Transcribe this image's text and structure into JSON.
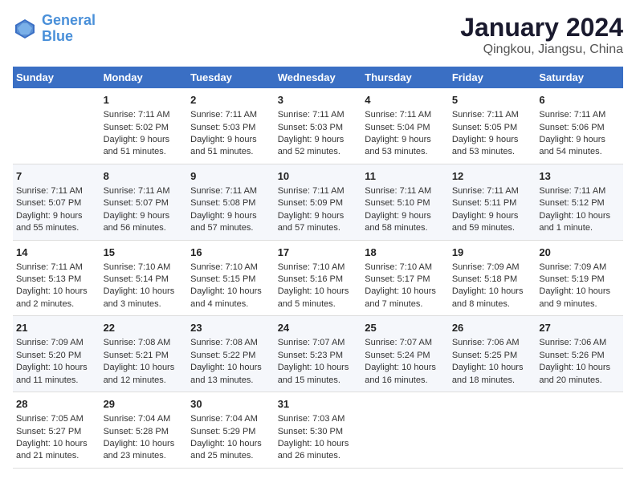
{
  "logo": {
    "line1": "General",
    "line2": "Blue"
  },
  "title": "January 2024",
  "subtitle": "Qingkou, Jiangsu, China",
  "days_of_week": [
    "Sunday",
    "Monday",
    "Tuesday",
    "Wednesday",
    "Thursday",
    "Friday",
    "Saturday"
  ],
  "weeks": [
    [
      {
        "day": "",
        "info": ""
      },
      {
        "day": "1",
        "info": "Sunrise: 7:11 AM\nSunset: 5:02 PM\nDaylight: 9 hours\nand 51 minutes."
      },
      {
        "day": "2",
        "info": "Sunrise: 7:11 AM\nSunset: 5:03 PM\nDaylight: 9 hours\nand 51 minutes."
      },
      {
        "day": "3",
        "info": "Sunrise: 7:11 AM\nSunset: 5:03 PM\nDaylight: 9 hours\nand 52 minutes."
      },
      {
        "day": "4",
        "info": "Sunrise: 7:11 AM\nSunset: 5:04 PM\nDaylight: 9 hours\nand 53 minutes."
      },
      {
        "day": "5",
        "info": "Sunrise: 7:11 AM\nSunset: 5:05 PM\nDaylight: 9 hours\nand 53 minutes."
      },
      {
        "day": "6",
        "info": "Sunrise: 7:11 AM\nSunset: 5:06 PM\nDaylight: 9 hours\nand 54 minutes."
      }
    ],
    [
      {
        "day": "7",
        "info": "Sunrise: 7:11 AM\nSunset: 5:07 PM\nDaylight: 9 hours\nand 55 minutes."
      },
      {
        "day": "8",
        "info": "Sunrise: 7:11 AM\nSunset: 5:07 PM\nDaylight: 9 hours\nand 56 minutes."
      },
      {
        "day": "9",
        "info": "Sunrise: 7:11 AM\nSunset: 5:08 PM\nDaylight: 9 hours\nand 57 minutes."
      },
      {
        "day": "10",
        "info": "Sunrise: 7:11 AM\nSunset: 5:09 PM\nDaylight: 9 hours\nand 57 minutes."
      },
      {
        "day": "11",
        "info": "Sunrise: 7:11 AM\nSunset: 5:10 PM\nDaylight: 9 hours\nand 58 minutes."
      },
      {
        "day": "12",
        "info": "Sunrise: 7:11 AM\nSunset: 5:11 PM\nDaylight: 9 hours\nand 59 minutes."
      },
      {
        "day": "13",
        "info": "Sunrise: 7:11 AM\nSunset: 5:12 PM\nDaylight: 10 hours\nand 1 minute."
      }
    ],
    [
      {
        "day": "14",
        "info": "Sunrise: 7:11 AM\nSunset: 5:13 PM\nDaylight: 10 hours\nand 2 minutes."
      },
      {
        "day": "15",
        "info": "Sunrise: 7:10 AM\nSunset: 5:14 PM\nDaylight: 10 hours\nand 3 minutes."
      },
      {
        "day": "16",
        "info": "Sunrise: 7:10 AM\nSunset: 5:15 PM\nDaylight: 10 hours\nand 4 minutes."
      },
      {
        "day": "17",
        "info": "Sunrise: 7:10 AM\nSunset: 5:16 PM\nDaylight: 10 hours\nand 5 minutes."
      },
      {
        "day": "18",
        "info": "Sunrise: 7:10 AM\nSunset: 5:17 PM\nDaylight: 10 hours\nand 7 minutes."
      },
      {
        "day": "19",
        "info": "Sunrise: 7:09 AM\nSunset: 5:18 PM\nDaylight: 10 hours\nand 8 minutes."
      },
      {
        "day": "20",
        "info": "Sunrise: 7:09 AM\nSunset: 5:19 PM\nDaylight: 10 hours\nand 9 minutes."
      }
    ],
    [
      {
        "day": "21",
        "info": "Sunrise: 7:09 AM\nSunset: 5:20 PM\nDaylight: 10 hours\nand 11 minutes."
      },
      {
        "day": "22",
        "info": "Sunrise: 7:08 AM\nSunset: 5:21 PM\nDaylight: 10 hours\nand 12 minutes."
      },
      {
        "day": "23",
        "info": "Sunrise: 7:08 AM\nSunset: 5:22 PM\nDaylight: 10 hours\nand 13 minutes."
      },
      {
        "day": "24",
        "info": "Sunrise: 7:07 AM\nSunset: 5:23 PM\nDaylight: 10 hours\nand 15 minutes."
      },
      {
        "day": "25",
        "info": "Sunrise: 7:07 AM\nSunset: 5:24 PM\nDaylight: 10 hours\nand 16 minutes."
      },
      {
        "day": "26",
        "info": "Sunrise: 7:06 AM\nSunset: 5:25 PM\nDaylight: 10 hours\nand 18 minutes."
      },
      {
        "day": "27",
        "info": "Sunrise: 7:06 AM\nSunset: 5:26 PM\nDaylight: 10 hours\nand 20 minutes."
      }
    ],
    [
      {
        "day": "28",
        "info": "Sunrise: 7:05 AM\nSunset: 5:27 PM\nDaylight: 10 hours\nand 21 minutes."
      },
      {
        "day": "29",
        "info": "Sunrise: 7:04 AM\nSunset: 5:28 PM\nDaylight: 10 hours\nand 23 minutes."
      },
      {
        "day": "30",
        "info": "Sunrise: 7:04 AM\nSunset: 5:29 PM\nDaylight: 10 hours\nand 25 minutes."
      },
      {
        "day": "31",
        "info": "Sunrise: 7:03 AM\nSunset: 5:30 PM\nDaylight: 10 hours\nand 26 minutes."
      },
      {
        "day": "",
        "info": ""
      },
      {
        "day": "",
        "info": ""
      },
      {
        "day": "",
        "info": ""
      }
    ]
  ]
}
